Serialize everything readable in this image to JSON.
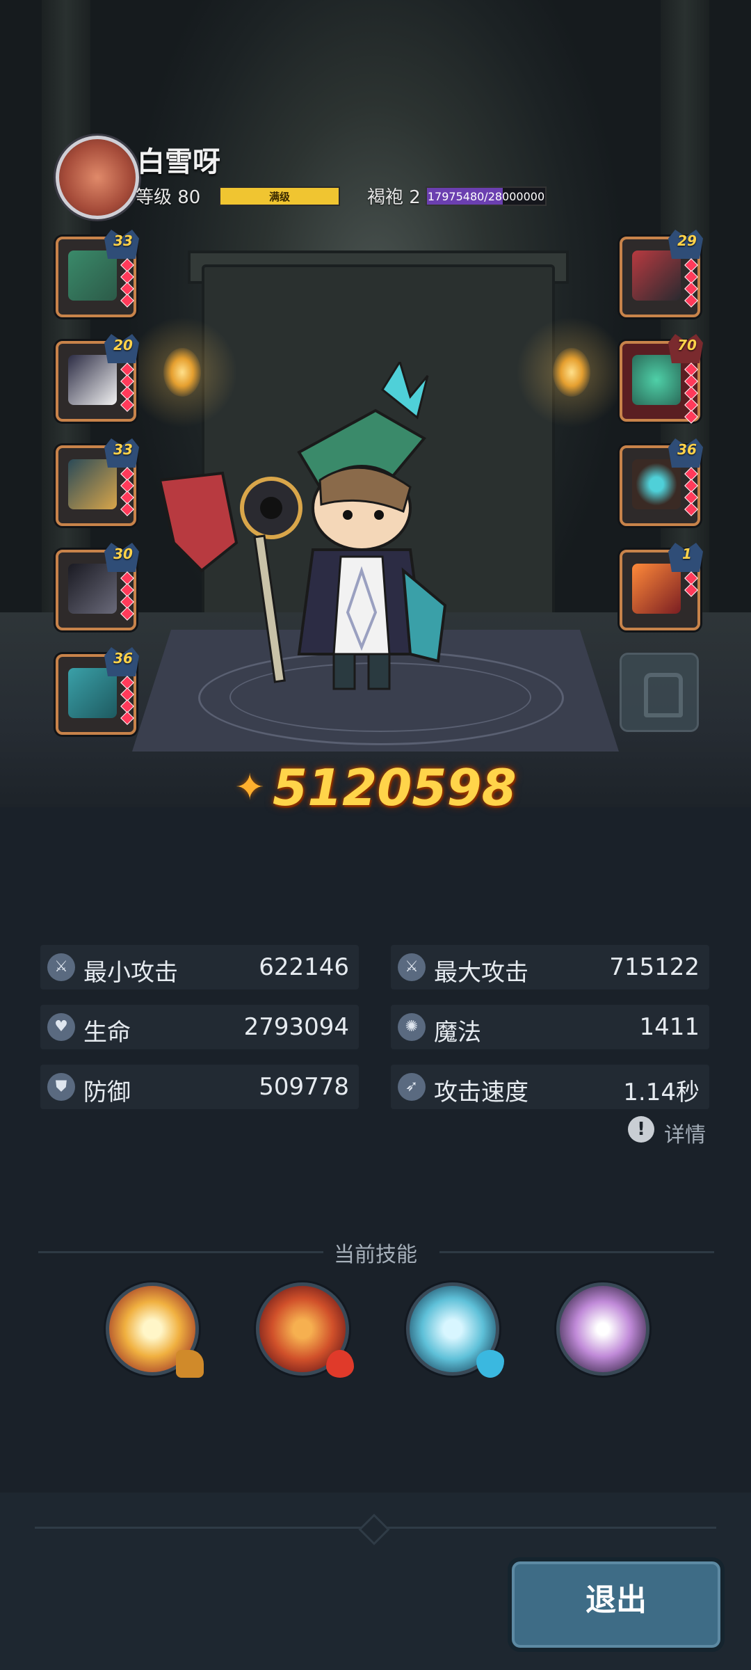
{
  "player": {
    "name": "白雪呀",
    "level_label": "等级 80",
    "level_status": "满级",
    "class_label": "褐袍 2",
    "exp_text": "17975480/28000000",
    "exp_progress": 0.642
  },
  "equipment_left": [
    {
      "level": "33",
      "icon": "hat-icon"
    },
    {
      "level": "20",
      "icon": "armor-icon"
    },
    {
      "level": "33",
      "icon": "boots-icon"
    },
    {
      "level": "30",
      "icon": "sleeve-icon"
    },
    {
      "level": "36",
      "icon": "cape-icon"
    }
  ],
  "equipment_right": [
    {
      "level": "29",
      "icon": "axe-icon"
    },
    {
      "level": "70",
      "icon": "pet-icon"
    },
    {
      "level": "36",
      "icon": "necklace-icon"
    },
    {
      "level": "1",
      "icon": "emblem-icon"
    }
  ],
  "combat_power": "5120598",
  "stats": [
    {
      "label": "最小攻击",
      "value": "622146",
      "icon": "sword-icon"
    },
    {
      "label": "最大攻击",
      "value": "715122",
      "icon": "sword-icon"
    },
    {
      "label": "生命",
      "value": "2793094",
      "icon": "heart-icon"
    },
    {
      "label": "魔法",
      "value": "1411",
      "icon": "magic-icon"
    },
    {
      "label": "防御",
      "value": "509778",
      "icon": "shield-icon"
    },
    {
      "label": "攻击速度",
      "value": "1.14秒",
      "icon": "speed-icon"
    }
  ],
  "details_label": "详情",
  "skills_title": "当前技能",
  "skills": [
    {
      "icon": "explosion-skill-icon",
      "element": "earth-element-icon"
    },
    {
      "icon": "fire-vortex-skill-icon",
      "element": "fire-element-icon"
    },
    {
      "icon": "ice-crystal-skill-icon",
      "element": "water-element-icon"
    },
    {
      "icon": "lightning-skill-icon",
      "element": ""
    }
  ],
  "exit_label": "退出",
  "colors": {
    "level_bar": "#f0c531",
    "exp_bar": "#6b3fb0",
    "slot_border": "#c8834a",
    "power_text": "#ffd44a",
    "exit_button": "#3e6c86"
  }
}
